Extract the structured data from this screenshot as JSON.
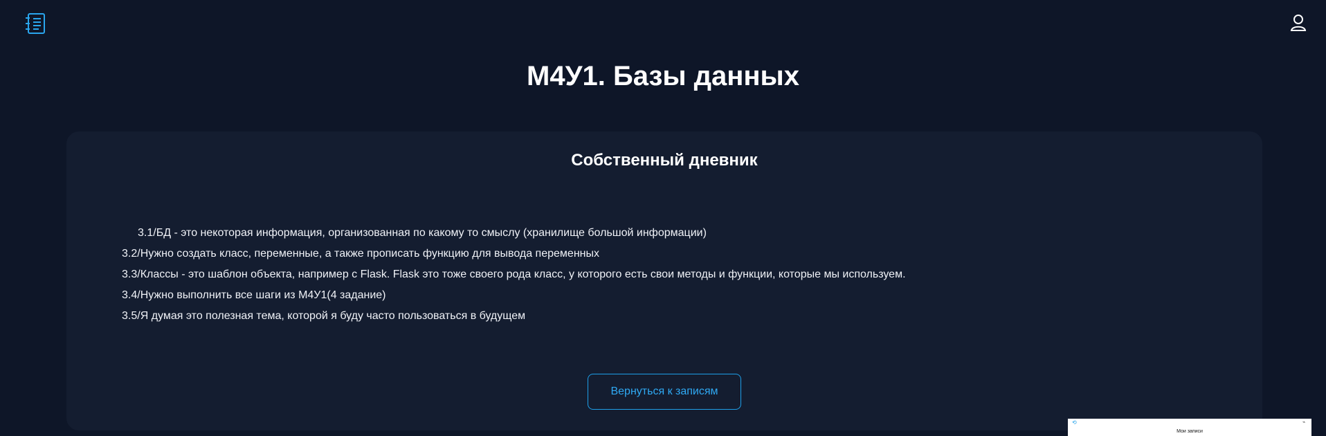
{
  "page": {
    "title": "М4У1. Базы данных"
  },
  "card": {
    "title": "Собственный дневник",
    "lines": [
      "3.1/БД - это некоторая информация, организованная по какому то смыслу (хранилище большой информации)",
      "3.2/Нужно создать класс, переменные, а также прописать функцию для вывода переменных",
      "3.3/Классы - это шаблон объекта,  например с Flask. Flask это тоже своего рода класс, у которого есть свои методы и функции, которые мы используем.",
      "3.4/Нужно выполнить все шаги из М4У1(4 задание)",
      "3.5/Я думая это полезная тема, которой я буду часто пользоваться в будущем"
    ],
    "back_button_label": "Вернуться к записям"
  },
  "mini_preview": {
    "label": "Мои записи"
  },
  "icons": {
    "logo": "notebook-list-icon",
    "profile": "user-profile-icon"
  },
  "colors": {
    "background": "#0e1628",
    "card": "#141d30",
    "accent": "#1ea0ea",
    "text": "#f0f2f7"
  }
}
